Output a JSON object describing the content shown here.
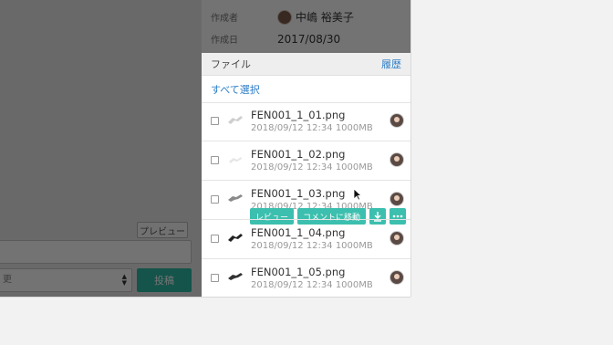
{
  "left": {
    "preview_label": "プレビュー",
    "select_value": "更",
    "post_label": "投稿"
  },
  "meta": {
    "creator_key": "作成者",
    "creator_name": "中嶋 裕美子",
    "date_key": "作成日",
    "date_value": "2017/08/30"
  },
  "files": {
    "header": "ファイル",
    "history": "履歴",
    "select_all": "すべて選択",
    "items": [
      {
        "name": "FEN001_1_01.png",
        "meta": "2018/09/12 12:34  1000MB"
      },
      {
        "name": "FEN001_1_02.png",
        "meta": "2018/09/12 12:34  1000MB"
      },
      {
        "name": "FEN001_1_03.png",
        "meta": "2018/09/12 12:34  1000MB"
      },
      {
        "name": "FEN001_1_04.png",
        "meta": "2018/09/12 12:34  1000MB"
      },
      {
        "name": "FEN001_1_05.png",
        "meta": "2018/09/12 12:34  1000MB"
      }
    ]
  },
  "actions": {
    "review": "レビュー",
    "move_to_comment": "コメントに移動",
    "download_icon": "download-icon",
    "more_icon": "more-icon"
  },
  "colors": {
    "accent": "#3cbfae",
    "link": "#2b7cc6"
  }
}
